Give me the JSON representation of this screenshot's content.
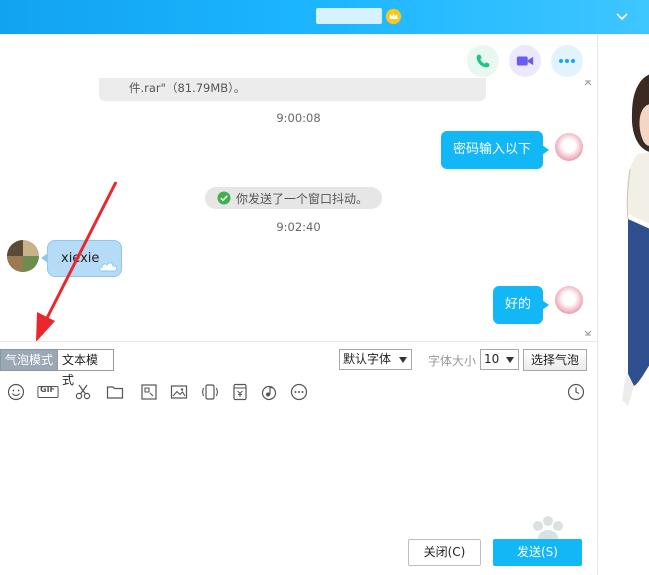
{
  "window": {
    "title_badge_icon": "level-crown-icon",
    "collapse_icon": "chevron-down-icon"
  },
  "actions": {
    "phone_icon": "phone-icon",
    "video_icon": "video-call-icon",
    "more_icon": "more-icon"
  },
  "messages": {
    "file_caption": "件.rar\"（81.79MB）。",
    "time_1": "9:00:08",
    "msg_1": "密码输入以下",
    "notice": "你发送了一个窗口抖动。",
    "time_2": "9:02:40",
    "msg_2": "xiexie",
    "msg_3": "好的"
  },
  "modebar": {
    "bubble_mode": "气泡模式",
    "text_mode": "文本模式",
    "font_select": "默认字体",
    "size_label": "字体大小",
    "size_select": "10",
    "choose_bubble": "选择气泡"
  },
  "toolbar": {
    "items": [
      "emoji-icon",
      "gif-icon",
      "screenshot-scissors-icon",
      "folder-icon",
      "image-doodle-icon",
      "picture-icon",
      "shake-window-icon",
      "red-packet-icon",
      "music-icon",
      "more-circle-icon",
      "history-clock-icon"
    ],
    "gif_label": "GIF"
  },
  "footer": {
    "close_label": "关闭(C)",
    "send_label": "发送(S)"
  },
  "colors": {
    "title_bar": "#1cb6ff",
    "bubble_self": "#12b7f5",
    "bubble_other": "#b5dbf7",
    "annotation": "#e8282d"
  }
}
